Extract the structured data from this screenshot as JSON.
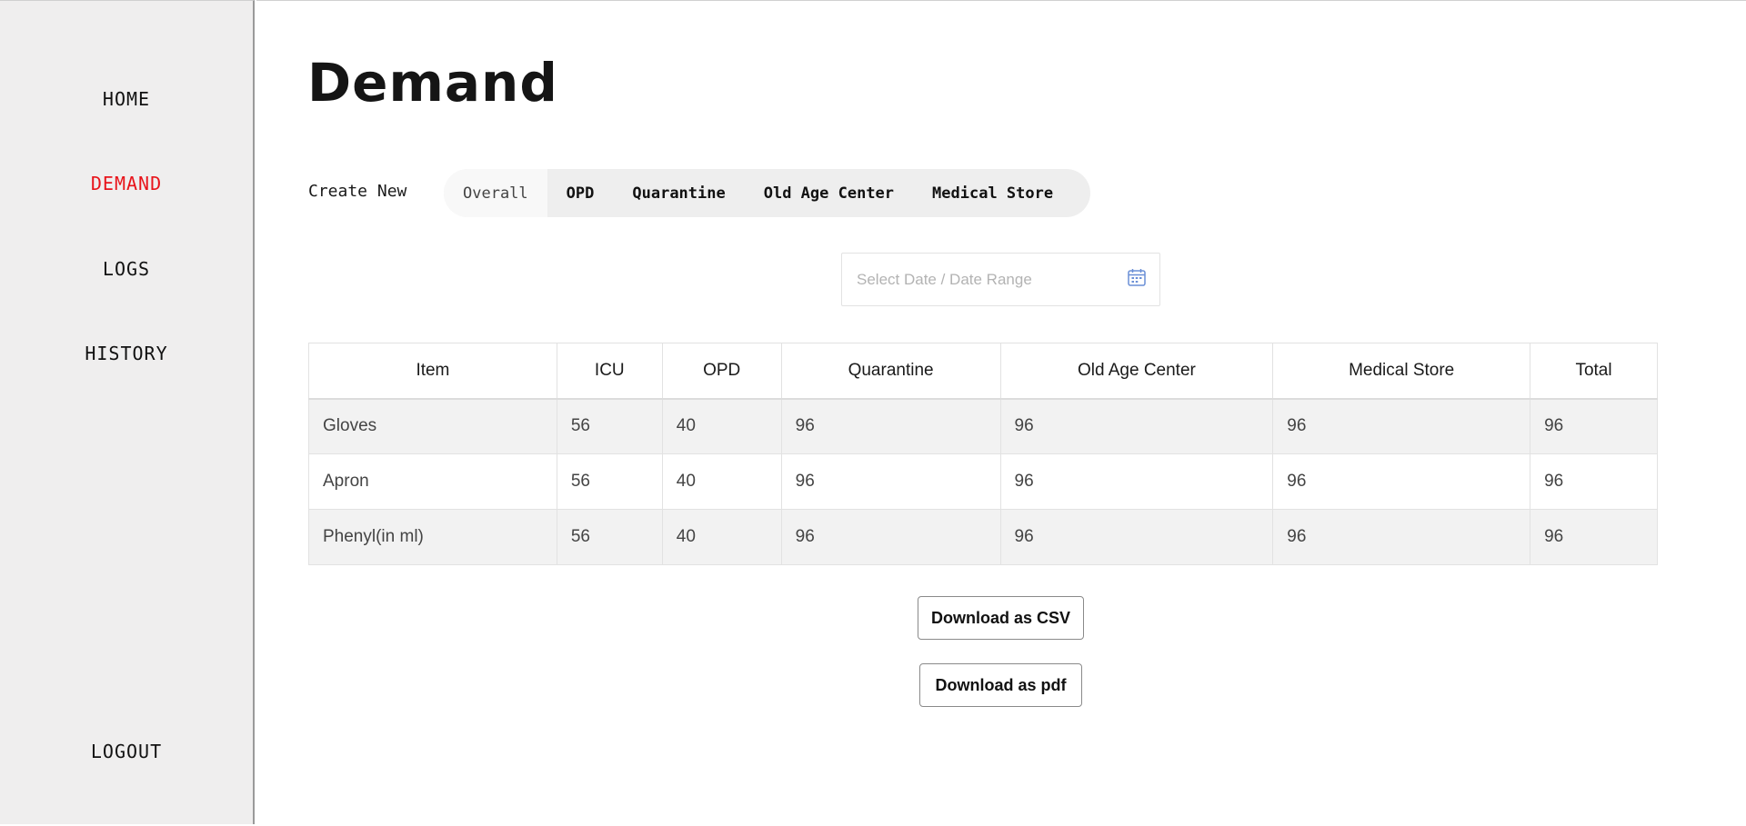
{
  "sidebar": {
    "items": [
      {
        "label": "HOME",
        "active": false
      },
      {
        "label": "DEMAND",
        "active": true
      },
      {
        "label": "LOGS",
        "active": false
      },
      {
        "label": "HISTORY",
        "active": false
      }
    ],
    "logout_label": "LOGOUT",
    "active_color": "#e8141b"
  },
  "main": {
    "title": "Demand",
    "create_new_label": "Create New",
    "tabs": [
      {
        "label": "Overall",
        "active": true
      },
      {
        "label": "OPD",
        "active": false
      },
      {
        "label": "Quarantine",
        "active": false
      },
      {
        "label": "Old Age Center",
        "active": false
      },
      {
        "label": "Medical Store",
        "active": false
      }
    ],
    "date_picker": {
      "placeholder": "Select Date / Date Range",
      "icon": "calendar-icon"
    },
    "table": {
      "headers": [
        "Item",
        "ICU",
        "OPD",
        "Quarantine",
        "Old Age Center",
        "Medical Store",
        "Total"
      ],
      "rows": [
        [
          "Gloves",
          "56",
          "40",
          "96",
          "96",
          "96",
          "96"
        ],
        [
          "Apron",
          "56",
          "40",
          "96",
          "96",
          "96",
          "96"
        ],
        [
          "Phenyl(in ml)",
          "56",
          "40",
          "96",
          "96",
          "96",
          "96"
        ]
      ]
    },
    "download_csv_label": "Download as CSV",
    "download_pdf_label": "Download as pdf"
  }
}
